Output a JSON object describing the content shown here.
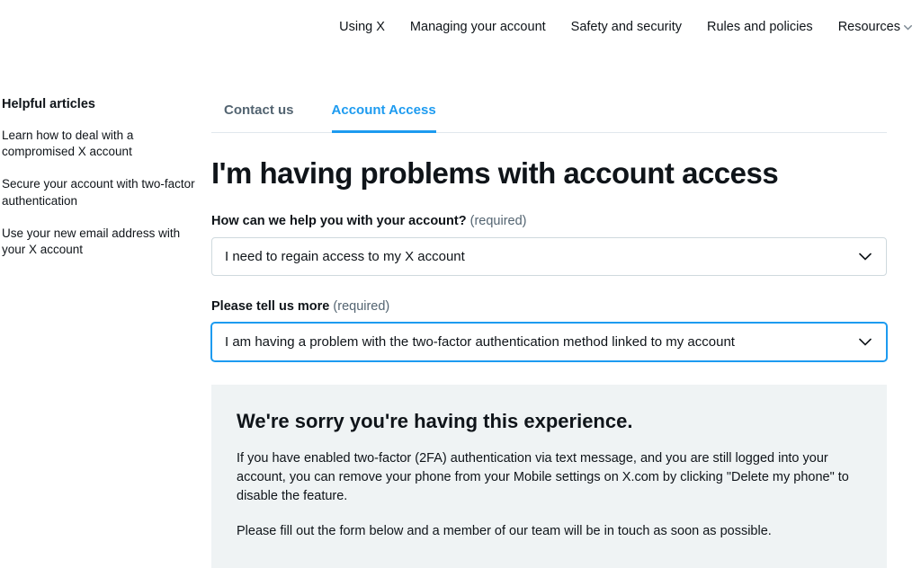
{
  "topnav": {
    "items": [
      {
        "label": "Using X"
      },
      {
        "label": "Managing your account"
      },
      {
        "label": "Safety and security"
      },
      {
        "label": "Rules and policies"
      },
      {
        "label": "Resources",
        "dropdown": true
      }
    ]
  },
  "sidebar": {
    "title": "Helpful articles",
    "links": [
      "Learn how to deal with a compromised X account",
      "Secure your account with two-factor authentication",
      "Use your new email address with your X account"
    ]
  },
  "tabs": {
    "contact": "Contact us",
    "access": "Account Access"
  },
  "page_title": "I'm having problems with account access",
  "field1": {
    "label": "How can we help you with your account?",
    "required": "(required)",
    "value": "I need to regain access to my X account"
  },
  "field2": {
    "label": "Please tell us more",
    "required": "(required)",
    "value": "I am having a problem with the two-factor authentication method linked to my account"
  },
  "info": {
    "heading": "We're sorry you're having this experience.",
    "p1": "If you have enabled two-factor (2FA) authentication via text message, and you are still logged into your account, you can remove your phone from your Mobile settings on X.com by clicking \"Delete my phone\" to disable the feature.",
    "p2": "Please fill out the form below and a member of our team will be in touch as soon as possible."
  }
}
